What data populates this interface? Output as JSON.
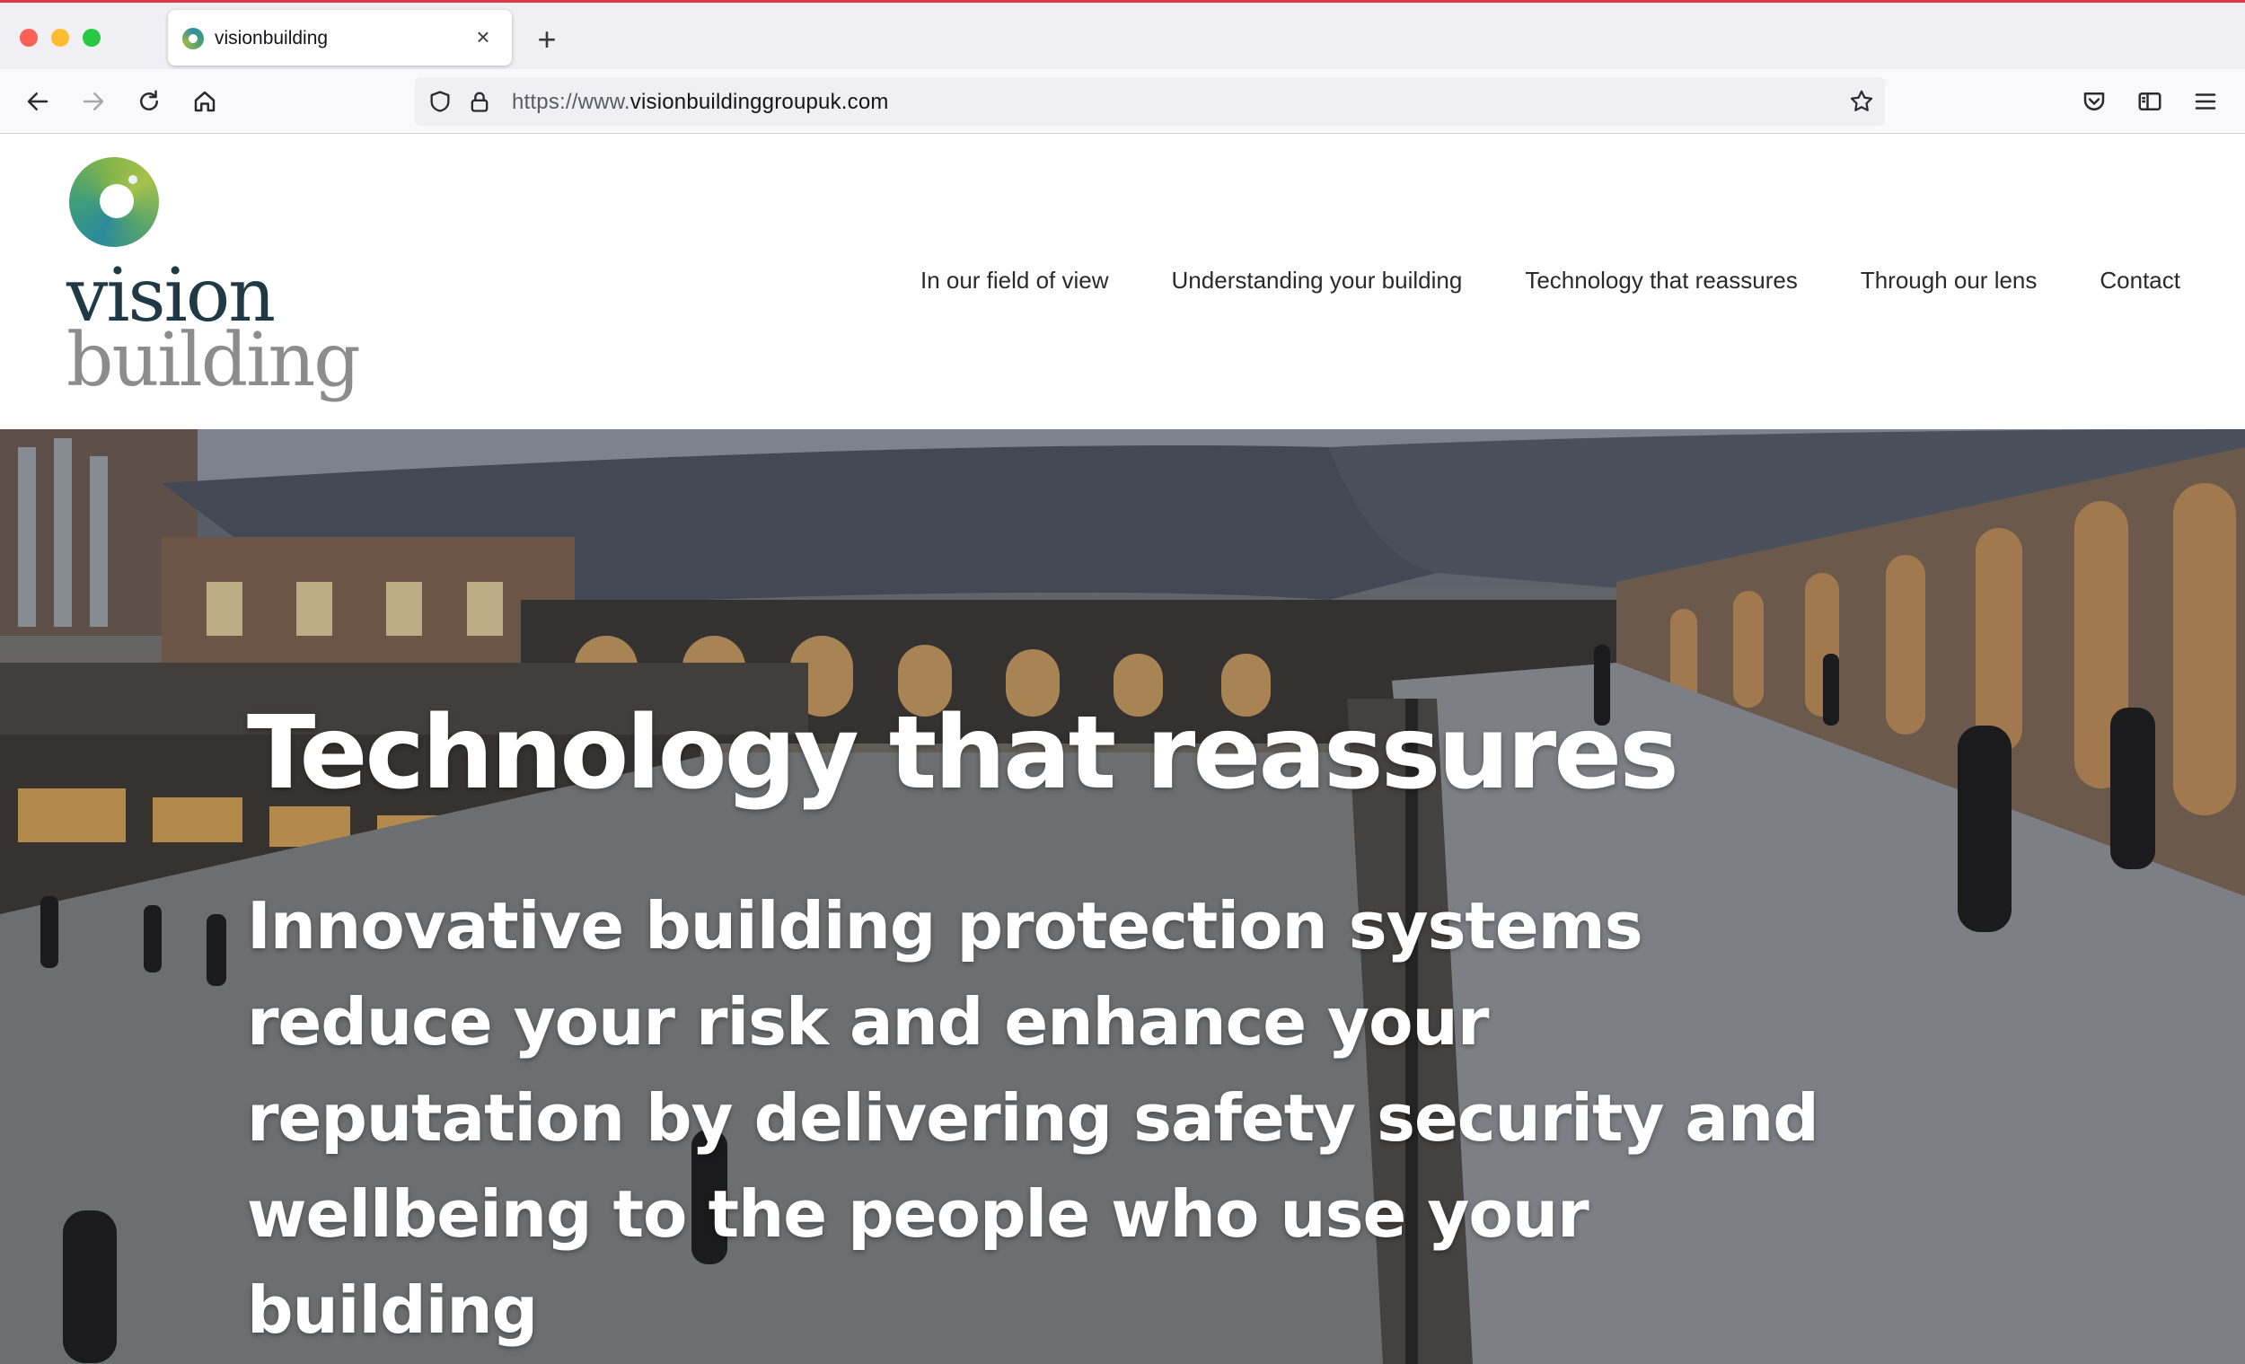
{
  "browser": {
    "tab": {
      "title": "visionbuilding",
      "favicon": "visionbuilding-logo-icon"
    },
    "url": {
      "prefix": "https://www.",
      "domain": "visionbuildinggroupuk.com"
    },
    "colors": {
      "accent": "#e3374a",
      "close": "#fe5f57",
      "minimize": "#febc2e",
      "maximize": "#28c840"
    }
  },
  "site": {
    "logo": {
      "line1": "vision",
      "line2": "building"
    },
    "nav": [
      {
        "label": "In our field of view"
      },
      {
        "label": "Understanding your building"
      },
      {
        "label": "Technology that reassures"
      },
      {
        "label": "Through our lens"
      },
      {
        "label": "Contact"
      }
    ]
  },
  "hero": {
    "title": "Technology that reassures",
    "subtitle": "Innovative building protection systems reduce your risk and enhance your reputation by delivering safety security and wellbeing to the people who use your building"
  }
}
